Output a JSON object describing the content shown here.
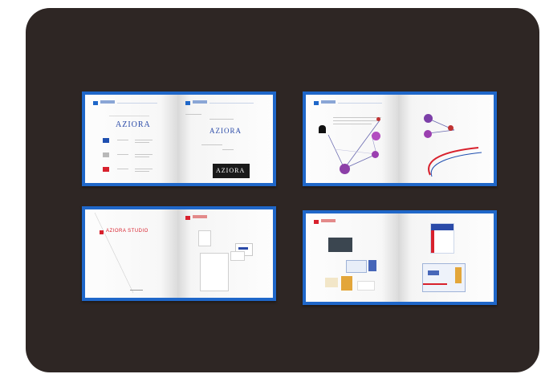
{
  "spreads": [
    {
      "id": "identity",
      "wordmark_left": "AZIORA",
      "wordmark_right": "AZIORA",
      "wordmark_dark": "AZIORA",
      "swatches": [
        "#1f4fb0",
        "#b9b9b9",
        "#d8212d"
      ]
    },
    {
      "id": "illustration"
    },
    {
      "id": "cover",
      "title_text": "AZIORA STUDIO"
    },
    {
      "id": "collateral"
    }
  ],
  "colors": {
    "board": "#2e2624",
    "frame": "#1f67c9",
    "accent_red": "#d8212d",
    "accent_blue": "#1f4fb0"
  }
}
